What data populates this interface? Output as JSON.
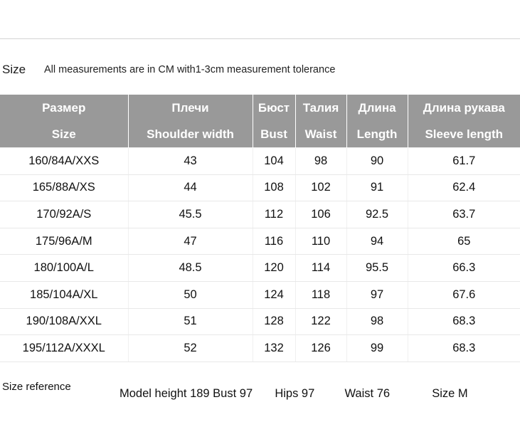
{
  "caption": {
    "label": "Size",
    "note": "All measurements are in CM with1-3cm measurement tolerance"
  },
  "table": {
    "headers_ru": [
      "Размер",
      "Плечи",
      "Бюст",
      "Талия",
      "Длина",
      "Длина рукава"
    ],
    "headers_en": [
      "Size",
      "Shoulder width",
      "Bust",
      "Waist",
      "Length",
      "Sleeve length"
    ],
    "rows": [
      [
        "160/84A/XXS",
        "43",
        "104",
        "98",
        "90",
        "61.7"
      ],
      [
        "165/88A/XS",
        "44",
        "108",
        "102",
        "91",
        "62.4"
      ],
      [
        "170/92A/S",
        "45.5",
        "112",
        "106",
        "92.5",
        "63.7"
      ],
      [
        "175/96A/M",
        "47",
        "116",
        "110",
        "94",
        "65"
      ],
      [
        "180/100A/L",
        "48.5",
        "120",
        "114",
        "95.5",
        "66.3"
      ],
      [
        "185/104A/XL",
        "50",
        "124",
        "118",
        "97",
        "67.6"
      ],
      [
        "190/108A/XXL",
        "51",
        "128",
        "122",
        "98",
        "68.3"
      ],
      [
        "195/112A/XXXL",
        "52",
        "132",
        "126",
        "99",
        "68.3"
      ]
    ]
  },
  "size_reference": {
    "label": "Size reference",
    "model_height": "Model height 189 Bust 97",
    "hips": "Hips 97",
    "waist": "Waist 76",
    "size": "Size M"
  },
  "colors": {
    "header_background": "#999999",
    "header_text": "#ffffff",
    "body_text": "#111111",
    "row_divider": "#e8e8e8",
    "top_rule": "#d4d4d4"
  }
}
